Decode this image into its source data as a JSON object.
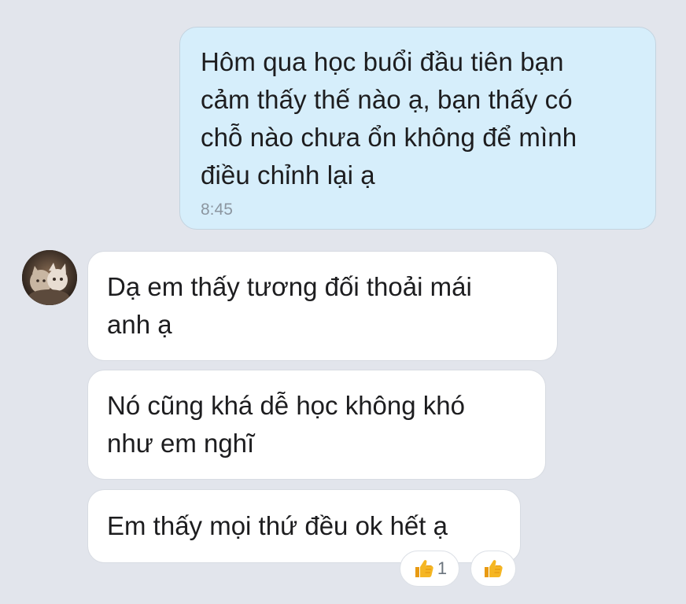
{
  "conversation": {
    "outgoing": {
      "text": "Hôm qua học buổi đầu tiên bạn cảm thấy thế nào ạ, bạn thấy có chỗ nào chưa ổn không để mình điều chỉnh lại ạ",
      "lines": [
        "Hôm qua học buổi đầu tiên bạn",
        "cảm thấy thế nào ạ, bạn thấy có",
        "chỗ nào chưa ổn không để mình",
        "điều chỉnh lại ạ"
      ],
      "time": "8:45"
    },
    "incoming": [
      {
        "lines": [
          "Dạ em thấy tương đối thoải mái",
          "anh ạ"
        ]
      },
      {
        "lines": [
          "Nó cũng khá dễ học không khó",
          "như em nghĩ"
        ]
      },
      {
        "lines": [
          "Em thấy mọi thứ đều ok hết ạ"
        ]
      }
    ],
    "reactions": {
      "like_icon": "thumbs-up-icon",
      "like_count": "1",
      "add_icon": "thumbs-up-icon"
    }
  },
  "colors": {
    "background": "#e2e5ec",
    "outgoing_bubble": "#d6eefb",
    "incoming_bubble": "#ffffff",
    "timestamp": "#8c96a0",
    "thumb": "#f5b623"
  }
}
